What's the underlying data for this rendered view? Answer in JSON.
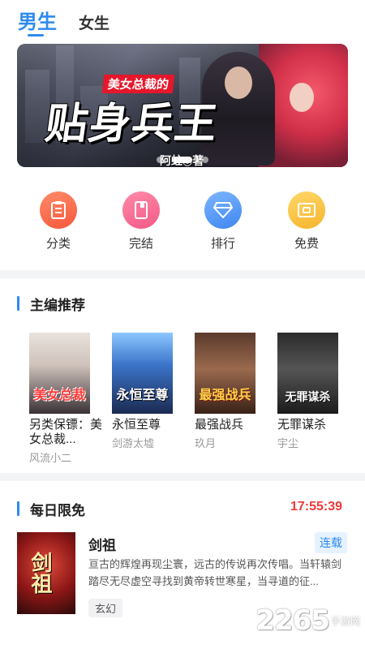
{
  "tabs": {
    "active": "男生",
    "inactive": "女生"
  },
  "banner": {
    "tag": "美女总裁的",
    "title": "贴身兵王",
    "author": "阿蛀◎著",
    "slides": 3,
    "active_slide": 2
  },
  "categories": [
    {
      "label": "分类",
      "icon": "clipboard-icon"
    },
    {
      "label": "完结",
      "icon": "book-icon"
    },
    {
      "label": "排行",
      "icon": "diamond-icon"
    },
    {
      "label": "免费",
      "icon": "ticket-icon"
    }
  ],
  "recommend": {
    "title": "主编推荐",
    "books": [
      {
        "title": "另类保镖：美女总裁...",
        "author": "风流小二",
        "cover_text": "美女总裁"
      },
      {
        "title": "永恒至尊",
        "author": "剑游太墟",
        "cover_text": "永恒至尊"
      },
      {
        "title": "最强战兵",
        "author": "玖月",
        "cover_text": "最强战兵"
      },
      {
        "title": "无罪谋杀",
        "author": "宇尘",
        "cover_text": "无罪谋杀"
      }
    ]
  },
  "daily_free": {
    "title": "每日限免",
    "countdown": "17:55:39",
    "book": {
      "name": "剑祖",
      "status": "连载",
      "description": "亘古的辉煌再现尘寰，远古的传说再次传唱。当轩辕剑踏尽无尽虚空寻找到黄帝转世寒星，当寻道的征...",
      "tag": "玄幻",
      "cover_text": "剑祖"
    }
  },
  "watermark": {
    "number": "2265",
    "text": "手游网"
  },
  "colors": {
    "accent": "#2e8bef",
    "timer": "#ef3a3a"
  }
}
